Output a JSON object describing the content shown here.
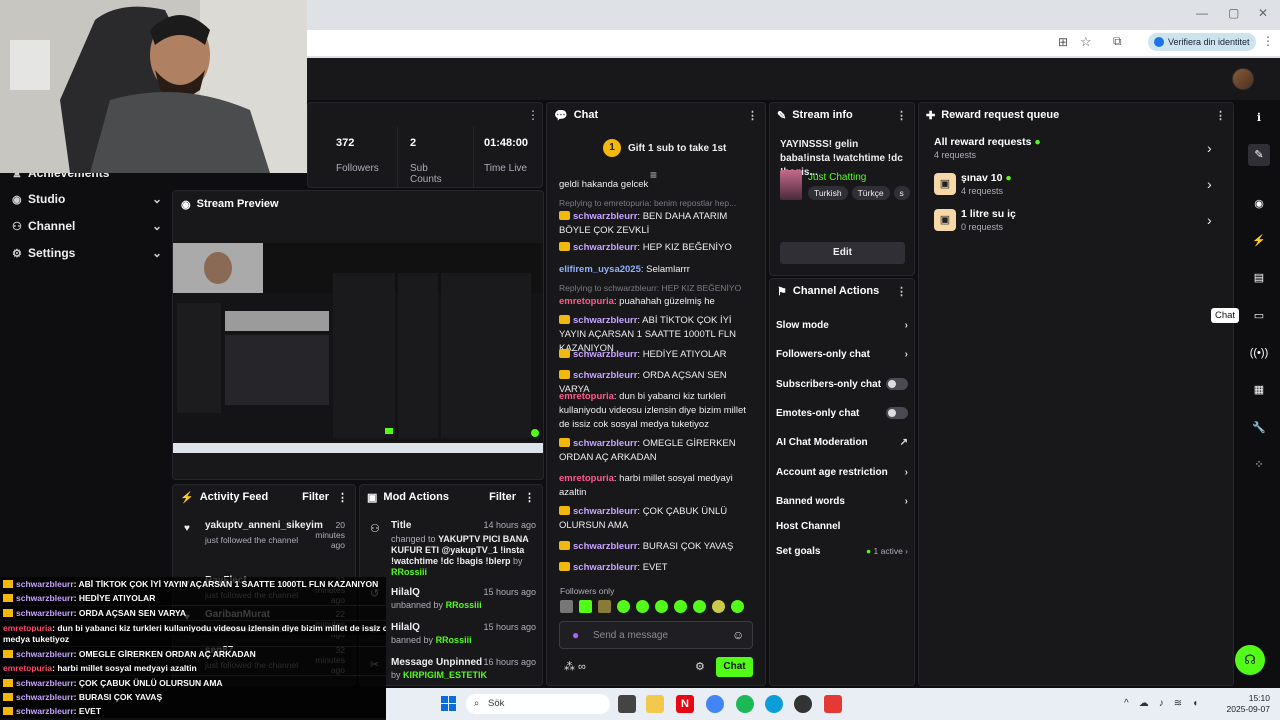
{
  "browser": {
    "verify_label": "Verifiera din identitet"
  },
  "nav": {
    "items": [
      {
        "label": "Achievements"
      },
      {
        "label": "Studio"
      },
      {
        "label": "Channel"
      },
      {
        "label": "Settings"
      }
    ]
  },
  "stats": [
    {
      "value": "372",
      "label": "Followers"
    },
    {
      "value": "2",
      "label": "Sub Counts"
    },
    {
      "value": "01:48:00",
      "label": "Time Live"
    }
  ],
  "preview": {
    "title": "Stream Preview"
  },
  "chat": {
    "title": "Chat",
    "gift_label": "Gift 1 sub to take 1st",
    "gift_count": "1",
    "top_fragment": "geldi hakanda gelcek",
    "messages": [
      {
        "reply": "Replying to emretopuria: benim repostlar hep...",
        "user": "schwarzbleurr",
        "text": ": BEN DAHA ATARIM BÖYLE ÇOK ZEVKLİ"
      },
      {
        "user": "schwarzbleurr",
        "text": ": HEP KIZ BEĞENİYO"
      },
      {
        "user": "elifirem_uysa2025",
        "text": ": Selamlarrr"
      },
      {
        "reply": "Replying to schwarzbleurr: HEP KIZ BEĞENİYO",
        "user": "emretopuria",
        "text": ": puahahah güzelmiş he"
      },
      {
        "user": "schwarzbleurr",
        "text": ": ABİ TİKTOK ÇOK İYİ YAYIN AÇARSAN 1 SAATTE 1000TL FLN KAZANIYON"
      },
      {
        "user": "schwarzbleurr",
        "text": ": HEDİYE ATIYOLAR"
      },
      {
        "user": "schwarzbleurr",
        "text": ": ORDA AÇSAN SEN VARYA"
      },
      {
        "user": "emretopuria",
        "text": ": dun bi yabanci kiz turkleri kullaniyodu videosu izlensin diye bizim millet de issiz cok sosyal medya tuketiyoz"
      },
      {
        "user": "schwarzbleurr",
        "text": ": OMEGLE GİRERKEN ORDAN AÇ ARKADAN"
      },
      {
        "user": "emretopuria",
        "text": ": harbi millet sosyal medyayi azaltin"
      },
      {
        "user": "schwarzbleurr",
        "text": ": ÇOK ÇABUK ÜNLÜ OLURSUN AMA"
      },
      {
        "user": "schwarzbleurr",
        "text": ": BURASI ÇOK YAVAŞ"
      },
      {
        "user": "schwarzbleurr",
        "text": ": EVET"
      }
    ],
    "followers_only": "Followers only",
    "input_placeholder": "Send a message",
    "send_label": "Chat"
  },
  "stream_info": {
    "title": "Stream info",
    "stream_title": "YAYINSSS! gelin baba!insta !watchtime !dc !bagis...",
    "category": "Just Chatting",
    "tags": [
      "Turkish",
      "Türkçe",
      "s"
    ],
    "edit_label": "Edit"
  },
  "channel_actions": {
    "title": "Channel Actions",
    "items": [
      {
        "label": "Slow mode"
      },
      {
        "label": "Followers-only chat"
      },
      {
        "label": "Subscribers-only chat"
      },
      {
        "label": "Emotes-only chat"
      },
      {
        "label": "AI Chat Moderation"
      },
      {
        "label": "Account age restriction"
      },
      {
        "label": "Banned words"
      },
      {
        "label": "Host Channel"
      },
      {
        "label": "Set goals"
      }
    ],
    "goals_status": "1 active"
  },
  "reward_queue": {
    "title": "Reward request queue",
    "items": [
      {
        "title": "All reward requests",
        "sub": "4 requests"
      },
      {
        "title": "şınav 10",
        "sub": "4 requests"
      },
      {
        "title": "1 litre su iç",
        "sub": "0 requests"
      }
    ]
  },
  "activity": {
    "title": "Activity Feed",
    "filter": "Filter",
    "items": [
      {
        "user": "yakuptv_anneni_sikeyim",
        "time": "20 minutes ago",
        "action": "just followed the channel"
      },
      {
        "user": "RayFlect",
        "time": "22 minutes ago",
        "action": "just followed the channel"
      },
      {
        "user": "GaribanMurat",
        "time": "22 minutes ago",
        "action": "just followed the channel"
      },
      {
        "user": "sen87",
        "time": "32 minutes ago",
        "action": "just followed the channel"
      }
    ]
  },
  "mod_actions": {
    "title": "Mod Actions",
    "filter": "Filter",
    "items": [
      {
        "title": "Title",
        "time": "14 hours ago",
        "pre": "changed to",
        "text": "YAKUPTV PICI BANA KUFUR ETI @yakupTV_1 !insta !watchtime !dc !bagis !blerp",
        "by_pre": "by",
        "by": "RRossiii"
      },
      {
        "title": "HilalQ",
        "time": "15 hours ago",
        "pre": "unbanned by",
        "by": "RRossiii"
      },
      {
        "title": "HilalQ",
        "time": "15 hours ago",
        "pre": "banned by",
        "by": "RRossiii"
      },
      {
        "title": "Message Unpinned",
        "time": "16 hours ago",
        "pre": "by",
        "by": "KIRPIGIM_ESTETIK"
      }
    ]
  },
  "overlay_chat": [
    {
      "user": "schwarzbleurr",
      "text": ": ABİ TİKTOK ÇOK İYİ YAYIN AÇARSAN 1 SAATTE 1000TL FLN KAZANIYON"
    },
    {
      "user": "schwarzbleurr",
      "text": ": HEDİYE ATIYOLAR"
    },
    {
      "user": "schwarzbleurr",
      "text": ": ORDA AÇSAN SEN VARYA"
    },
    {
      "user": "emretopuria",
      "text": ": dun bi yabanci kiz turkleri kullaniyodu videosu izlensin diye bizim millet de issiz cok sosyal"
    },
    {
      "user": "",
      "text": "medya tuketiyoz"
    },
    {
      "user": "schwarzbleurr",
      "text": ": OMEGLE GİRERKEN ORDAN AÇ ARKADAN"
    },
    {
      "user": "emretopuria",
      "text": ": harbi millet sosyal medyayi azaltin"
    },
    {
      "user": "schwarzbleurr",
      "text": ": ÇOK ÇABUK ÜNLÜ OLURSUN AMA"
    },
    {
      "user": "schwarzbleurr",
      "text": ": BURASI ÇOK YAVAŞ"
    },
    {
      "user": "schwarzbleurr",
      "text": ": EVET"
    }
  ],
  "tooltip": "Chat",
  "taskbar": {
    "search": "Sök",
    "time": "15:10",
    "date": "2025-09-07"
  }
}
